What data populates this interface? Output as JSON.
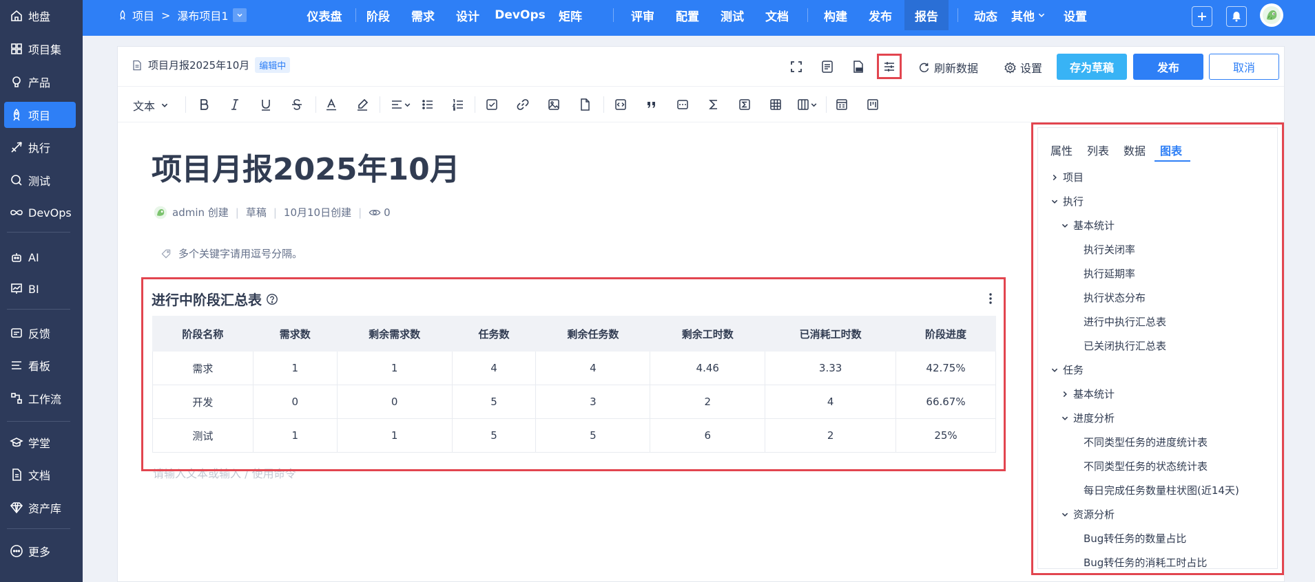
{
  "sidebar": {
    "items": [
      {
        "label": "地盘",
        "icon": "home-icon"
      },
      {
        "label": "项目集",
        "icon": "grid-icon"
      },
      {
        "label": "产品",
        "icon": "bulb-icon"
      },
      {
        "label": "项目",
        "icon": "rocket-icon",
        "active": true
      },
      {
        "label": "执行",
        "icon": "send-icon"
      },
      {
        "label": "测试",
        "icon": "search-icon"
      },
      {
        "label": "DevOps",
        "icon": "infinity-icon"
      },
      {
        "label": "AI",
        "icon": "robot-icon"
      },
      {
        "label": "BI",
        "icon": "chart-icon"
      },
      {
        "label": "反馈",
        "icon": "feedback-icon"
      },
      {
        "label": "看板",
        "icon": "kanban-icon"
      },
      {
        "label": "工作流",
        "icon": "workflow-icon"
      },
      {
        "label": "学堂",
        "icon": "academy-icon"
      },
      {
        "label": "文档",
        "icon": "doc-icon"
      },
      {
        "label": "资产库",
        "icon": "diamond-icon"
      },
      {
        "label": "更多",
        "icon": "more-icon"
      }
    ]
  },
  "topbar": {
    "crumb_project": "项目",
    "crumb_current": "瀑布项目1",
    "tabs": [
      "仪表盘",
      "阶段",
      "需求",
      "设计",
      "DevOps",
      "矩阵",
      "评审",
      "配置",
      "测试",
      "文档",
      "构建",
      "发布",
      "报告",
      "动态",
      "其他",
      "设置"
    ],
    "active_tab": "报告"
  },
  "doc": {
    "file_title": "项目月报2025年10月",
    "status_badge": "编辑中",
    "refresh_label": "刷新数据",
    "settings_label": "设置",
    "save_draft_label": "存为草稿",
    "publish_label": "发布",
    "cancel_label": "取消",
    "text_style_label": "文本",
    "title": "项目月报2025年10月",
    "meta_author": "admin 创建",
    "meta_status": "草稿",
    "meta_date": "10月10日创建",
    "meta_views": "0",
    "keywords_placeholder": "多个关键字请用逗号分隔。",
    "editor_placeholder": "请输入文本或输入 / 使用命令"
  },
  "table": {
    "title": "进行中阶段汇总表",
    "headers": [
      "阶段名称",
      "需求数",
      "剩余需求数",
      "任务数",
      "剩余任务数",
      "剩余工时数",
      "已消耗工时数",
      "阶段进度"
    ],
    "rows": [
      [
        "需求",
        "1",
        "1",
        "4",
        "4",
        "4.46",
        "3.33",
        "42.75%"
      ],
      [
        "开发",
        "0",
        "0",
        "5",
        "3",
        "2",
        "4",
        "66.67%"
      ],
      [
        "测试",
        "1",
        "1",
        "5",
        "5",
        "6",
        "2",
        "25%"
      ]
    ]
  },
  "right_panel": {
    "tabs": [
      "属性",
      "列表",
      "数据",
      "图表"
    ],
    "active_tab": "图表",
    "tree": [
      {
        "label": "项目",
        "level": 0,
        "arrow": "right"
      },
      {
        "label": "执行",
        "level": 0,
        "arrow": "down"
      },
      {
        "label": "基本统计",
        "level": 1,
        "arrow": "down"
      },
      {
        "label": "执行关闭率",
        "level": 2,
        "arrow": ""
      },
      {
        "label": "执行延期率",
        "level": 2,
        "arrow": ""
      },
      {
        "label": "执行状态分布",
        "level": 2,
        "arrow": ""
      },
      {
        "label": "进行中执行汇总表",
        "level": 2,
        "arrow": ""
      },
      {
        "label": "已关闭执行汇总表",
        "level": 2,
        "arrow": ""
      },
      {
        "label": "任务",
        "level": 0,
        "arrow": "down"
      },
      {
        "label": "基本统计",
        "level": 1,
        "arrow": "right"
      },
      {
        "label": "进度分析",
        "level": 1,
        "arrow": "down"
      },
      {
        "label": "不同类型任务的进度统计表",
        "level": 2,
        "arrow": ""
      },
      {
        "label": "不同类型任务的状态统计表",
        "level": 2,
        "arrow": ""
      },
      {
        "label": "每日完成任务数量柱状图(近14天)",
        "level": 2,
        "arrow": ""
      },
      {
        "label": "资源分析",
        "level": 1,
        "arrow": "down"
      },
      {
        "label": "Bug转任务的数量占比",
        "level": 2,
        "arrow": ""
      },
      {
        "label": "Bug转任务的消耗工时占比",
        "level": 2,
        "arrow": ""
      }
    ]
  },
  "colors": {
    "primary": "#2e7ff6",
    "sidebar_bg": "#2d3a5a",
    "highlight_red": "#e2454f",
    "save_draft_bg": "#38b3f5"
  }
}
